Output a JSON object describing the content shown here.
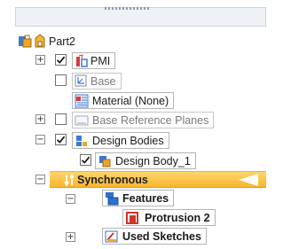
{
  "tree": {
    "root": {
      "label": "Part2"
    },
    "items": {
      "pmi": {
        "label": "PMI"
      },
      "base": {
        "label": "Base"
      },
      "material": {
        "label": "Material (None)"
      },
      "base_ref_planes": {
        "label": "Base Reference Planes"
      },
      "design_bodies": {
        "label": "Design Bodies"
      },
      "design_body_1": {
        "label": "Design Body_1"
      },
      "synchronous": {
        "label": "Synchronous"
      },
      "features": {
        "label": "Features"
      },
      "protrusion_2": {
        "label": "Protrusion 2"
      },
      "used_sketches": {
        "label": "Used Sketches"
      }
    }
  },
  "icons": {
    "root": "part-icon",
    "pmi": "pmi-icon",
    "base": "coordinate-system-icon",
    "material": "material-table-icon",
    "base_ref_planes": "reference-planes-icon",
    "design_bodies": "design-bodies-icon",
    "design_body_1": "design-body-icon",
    "synchronous": "synchronous-icon",
    "features": "features-icon",
    "protrusion_2": "protrusion-icon",
    "used_sketches": "sketch-icon"
  },
  "colors": {
    "synchronous_highlight": "#f8b52e",
    "label_border": "#b4b4b4",
    "check_mark": "#111111",
    "feature_blue": "#2f6fcf",
    "protrusion_red": "#d1342b"
  }
}
